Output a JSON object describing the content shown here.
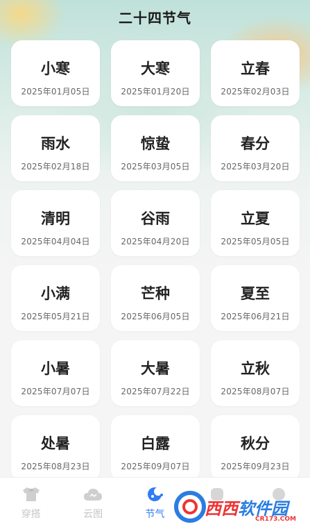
{
  "page": {
    "title": "二十四节气"
  },
  "terms": [
    {
      "name": "小寒",
      "date": "2025年01月05日"
    },
    {
      "name": "大寒",
      "date": "2025年01月20日"
    },
    {
      "name": "立春",
      "date": "2025年02月03日"
    },
    {
      "name": "雨水",
      "date": "2025年02月18日"
    },
    {
      "name": "惊蛰",
      "date": "2025年03月05日"
    },
    {
      "name": "春分",
      "date": "2025年03月20日"
    },
    {
      "name": "清明",
      "date": "2025年04月04日"
    },
    {
      "name": "谷雨",
      "date": "2025年04月20日"
    },
    {
      "name": "立夏",
      "date": "2025年05月05日"
    },
    {
      "name": "小满",
      "date": "2025年05月21日"
    },
    {
      "name": "芒种",
      "date": "2025年06月05日"
    },
    {
      "name": "夏至",
      "date": "2025年06月21日"
    },
    {
      "name": "小暑",
      "date": "2025年07月07日"
    },
    {
      "name": "大暑",
      "date": "2025年07月22日"
    },
    {
      "name": "立秋",
      "date": "2025年08月07日"
    },
    {
      "name": "处暑",
      "date": "2025年08月23日"
    },
    {
      "name": "白露",
      "date": "2025年09月07日"
    },
    {
      "name": "秋分",
      "date": "2025年09月23日"
    }
  ],
  "tabbar": {
    "items": [
      {
        "label": "穿搭",
        "icon": "shirt-icon"
      },
      {
        "label": "云图",
        "icon": "cloud-icon"
      },
      {
        "label": "节气",
        "icon": "solar-term-icon",
        "active": true
      },
      {
        "label": "",
        "icon": "tab4-icon"
      },
      {
        "label": "",
        "icon": "tab5-icon"
      }
    ],
    "active_color": "#2f7cf6",
    "inactive_color": "#c5c5c5"
  },
  "watermark": {
    "brand_a": "西西",
    "brand_b": "软件园",
    "domain": "CR173.COM"
  }
}
